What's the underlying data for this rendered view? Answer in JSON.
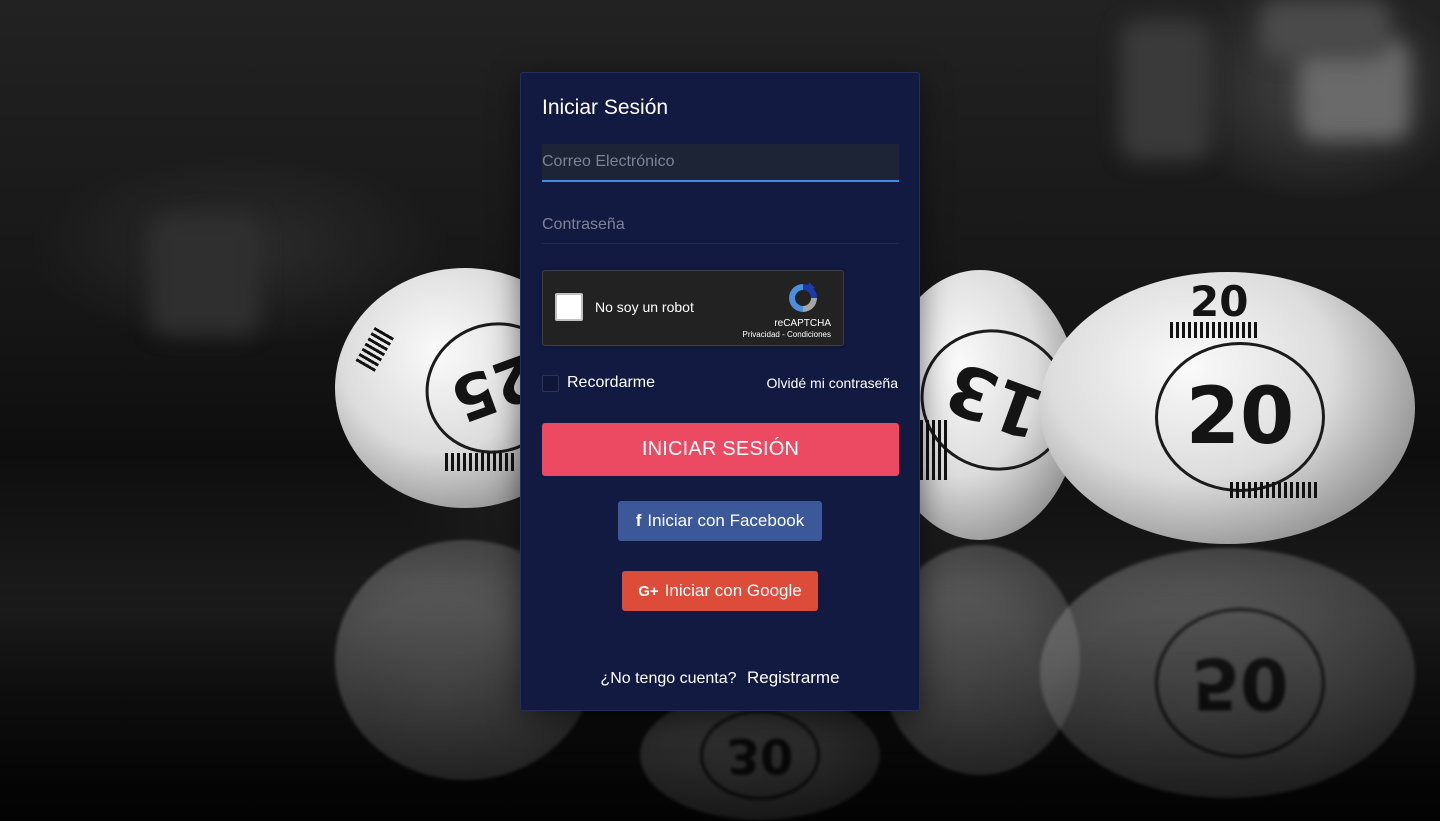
{
  "login": {
    "title": "Iniciar Sesión",
    "email_placeholder": "Correo Electrónico",
    "password_placeholder": "Contraseña",
    "recaptcha": {
      "label": "No soy un robot",
      "brand": "reCAPTCHA",
      "links": "Privacidad - Condiciones"
    },
    "remember_label": "Recordarme",
    "forgot_link": "Olvidé mi contraseña",
    "submit_label": "INICIAR SESIÓN",
    "facebook_label": "Iniciar con Facebook",
    "facebook_icon": "f",
    "google_label": "Iniciar con Google",
    "google_icon": "G+",
    "no_account_text": "¿No tengo cuenta?",
    "register_link": "Registrarme"
  },
  "background": {
    "ball_numbers": [
      "25",
      "13",
      "20",
      "20",
      "50",
      "30"
    ]
  },
  "colors": {
    "card_bg": "#121a42",
    "primary_button": "#ec4a62",
    "facebook": "#3b5998",
    "google": "#dd4b39",
    "focus_underline": "#3c8ee0"
  }
}
